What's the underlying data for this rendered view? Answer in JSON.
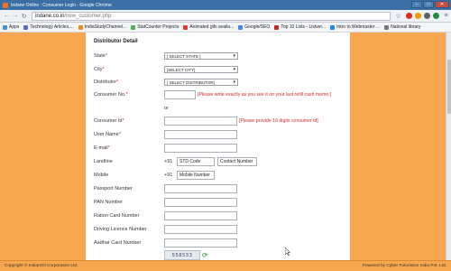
{
  "window": {
    "title": "Indane Online : Consumer Login - Google Chrome"
  },
  "address": {
    "host": "indane.co.in",
    "path": "/new_customer.php"
  },
  "bookmarks": [
    {
      "label": "Apps",
      "color": "#4a90d9"
    },
    {
      "label": "Technology Articles,...",
      "color": "#5c6bc0"
    },
    {
      "label": "IndiaStudyChannel...",
      "color": "#f08a24"
    },
    {
      "label": "StatCounter Projects",
      "color": "#4caf50"
    },
    {
      "label": "Animated gifs availa...",
      "color": "#e53935"
    },
    {
      "label": "Google/SEO",
      "color": "#4285f4"
    },
    {
      "label": "Top 10 Lists - Listver...",
      "color": "#c62828"
    },
    {
      "label": "Intro to Webmaster ...",
      "color": "#1e88e5"
    },
    {
      "label": "National library",
      "color": "#757575"
    }
  ],
  "form": {
    "section_title": "Distributor Detail",
    "state_label": "State",
    "state_value": "[ SELECT STATE ]",
    "city_label": "City",
    "city_value": "[SELECT CITY]",
    "distributor_label": "Distributor",
    "distributor_value": "[ SELECT DISTRIBUTOR]",
    "consumer_no_label": "Consumer No.",
    "consumer_no_hint": "[Please write exactly as you see it on your last refill cash memo.]",
    "or_text": "or",
    "consumer_id_label": "Consumer Id",
    "consumer_id_hint": "[Please provide 16 digits consumer id]",
    "username_label": "User Name",
    "email_label": "E-mail",
    "landline_label": "Landline",
    "landline_prefix": "+91",
    "std_placeholder": "STD Code",
    "contact_placeholder": "Contact Number",
    "mobile_label": "Mobile",
    "mobile_prefix": "+91",
    "mobile_placeholder": "Mobile Number",
    "passport_label": "Passport Number",
    "pan_label": "PAN Number",
    "ration_label": "Ration Card Number",
    "driving_label": "Driving Licence Number",
    "aadhar_label": "Aadhar Card Number",
    "captcha_text": "558533",
    "required_mark": "*"
  },
  "footer": {
    "left": "Copyright © IndianOil Corporation Ltd.",
    "right": "Powered by Cyber Futuristics India Pvt. Ltd."
  },
  "colors": {
    "accent_orange": "#f7a74f",
    "hint_red": "#d62828",
    "titlebar_blue": "#3a6ea5"
  }
}
